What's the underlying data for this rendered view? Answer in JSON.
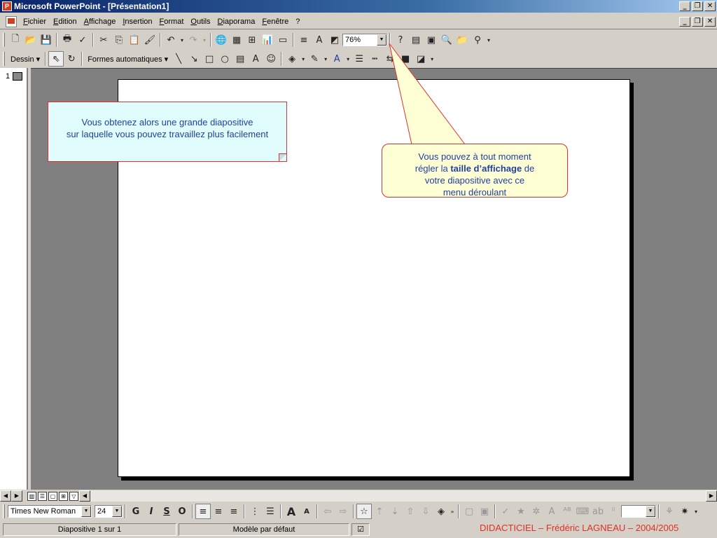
{
  "window": {
    "title": "Microsoft PowerPoint - [Présentation1]",
    "app_icon": "powerpoint-icon",
    "controls": [
      "_",
      "🗗",
      "✕"
    ]
  },
  "menu": {
    "items": [
      "Fichier",
      "Edition",
      "Affichage",
      "Insertion",
      "Format",
      "Outils",
      "Diaporama",
      "Fenêtre",
      "?"
    ]
  },
  "toolbar_standard": {
    "zoom_value": "76%"
  },
  "toolbar_drawing": {
    "draw_label": "Dessin ▾",
    "autoshapes_label": "Formes automatiques ▾"
  },
  "toolbar_formatting": {
    "font_name": "Times New Roman",
    "font_size": "24",
    "bold": "G",
    "italic": "I",
    "underline": "S",
    "shadow": "O",
    "font_grow": "A",
    "font_shrink": "A"
  },
  "outline": {
    "slide_number": "1"
  },
  "callouts": {
    "left_line1": "Vous obtenez alors une grande diapositive",
    "left_line2": "sur laquelle vous pouvez travaillez plus facilement",
    "right_line1": "Vous pouvez à tout moment",
    "right_line2_pre": "régler la ",
    "right_line2_bold": "taille d’affichage",
    "right_line2_post": " de",
    "right_line3": "votre diapositive avec ce",
    "right_line4": "menu déroulant"
  },
  "status": {
    "slide_info": "Diapositive 1 sur 1",
    "template": "Modèle par défaut",
    "credit": "DIDACTICIEL – Frédéric LAGNEAU – 2004/2005"
  },
  "colors": {
    "callout_border": "#e03030",
    "callout_text": "#1f3fa0",
    "credit": "#e03020"
  }
}
